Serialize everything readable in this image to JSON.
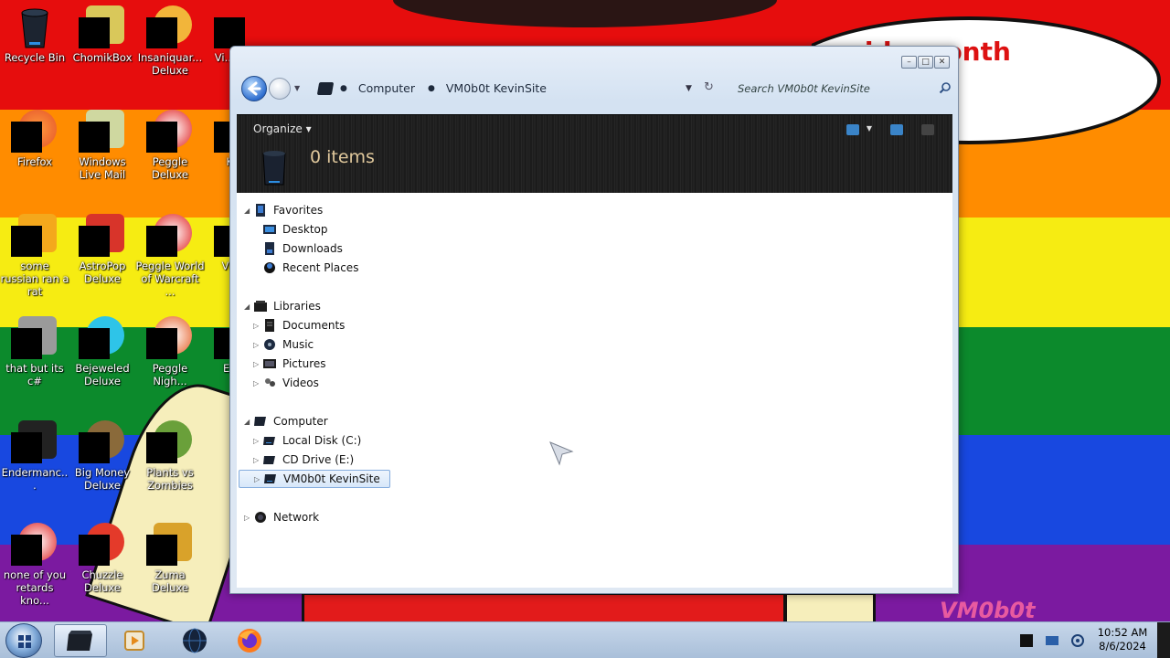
{
  "wallpaper": {
    "bubble_text": "I ...ride month",
    "watermark": "VM0b0t"
  },
  "desktop_icons": [
    {
      "label": "Recycle Bin"
    },
    {
      "label": "ChomikBox"
    },
    {
      "label": "Insaniquar... Deluxe"
    },
    {
      "label": "Vi... Ke..."
    },
    {
      "label": "Firefox"
    },
    {
      "label": "Windows Live Mail"
    },
    {
      "label": "Peggle Deluxe"
    },
    {
      "label": "Ke..."
    },
    {
      "label": "some russian ran a rat"
    },
    {
      "label": "AstroPop Deluxe"
    },
    {
      "label": "Peggle World of Warcraft ..."
    },
    {
      "label": "Visu..."
    },
    {
      "label": "that but its c#"
    },
    {
      "label": "Bejeweled Deluxe"
    },
    {
      "label": "Peggle Nigh..."
    },
    {
      "label": "Eve..."
    },
    {
      "label": "Endermanc..."
    },
    {
      "label": "Big Money Deluxe"
    },
    {
      "label": "Plants vs Zombies"
    },
    {
      "label": "none of you retards kno..."
    },
    {
      "label": "Chuzzle Deluxe"
    },
    {
      "label": "Zuma Deluxe"
    }
  ],
  "window": {
    "address": {
      "crumbs": [
        "Computer",
        "VM0b0t KevinSite"
      ]
    },
    "search_placeholder": "Search VM0b0t KevinSite",
    "toolbar": {
      "organize": "Organize ▾",
      "item_count": "0 items"
    },
    "nav": {
      "favorites": "Favorites",
      "desktop": "Desktop",
      "downloads": "Downloads",
      "recent": "Recent Places",
      "libraries": "Libraries",
      "documents": "Documents",
      "music": "Music",
      "pictures": "Pictures",
      "videos": "Videos",
      "computer": "Computer",
      "local_disk": "Local Disk (C:)",
      "cd_drive": "CD Drive (E:)",
      "site": "VM0b0t KevinSite",
      "network": "Network"
    }
  },
  "taskbar": {
    "time": "10:52 AM",
    "date": "8/6/2024"
  }
}
